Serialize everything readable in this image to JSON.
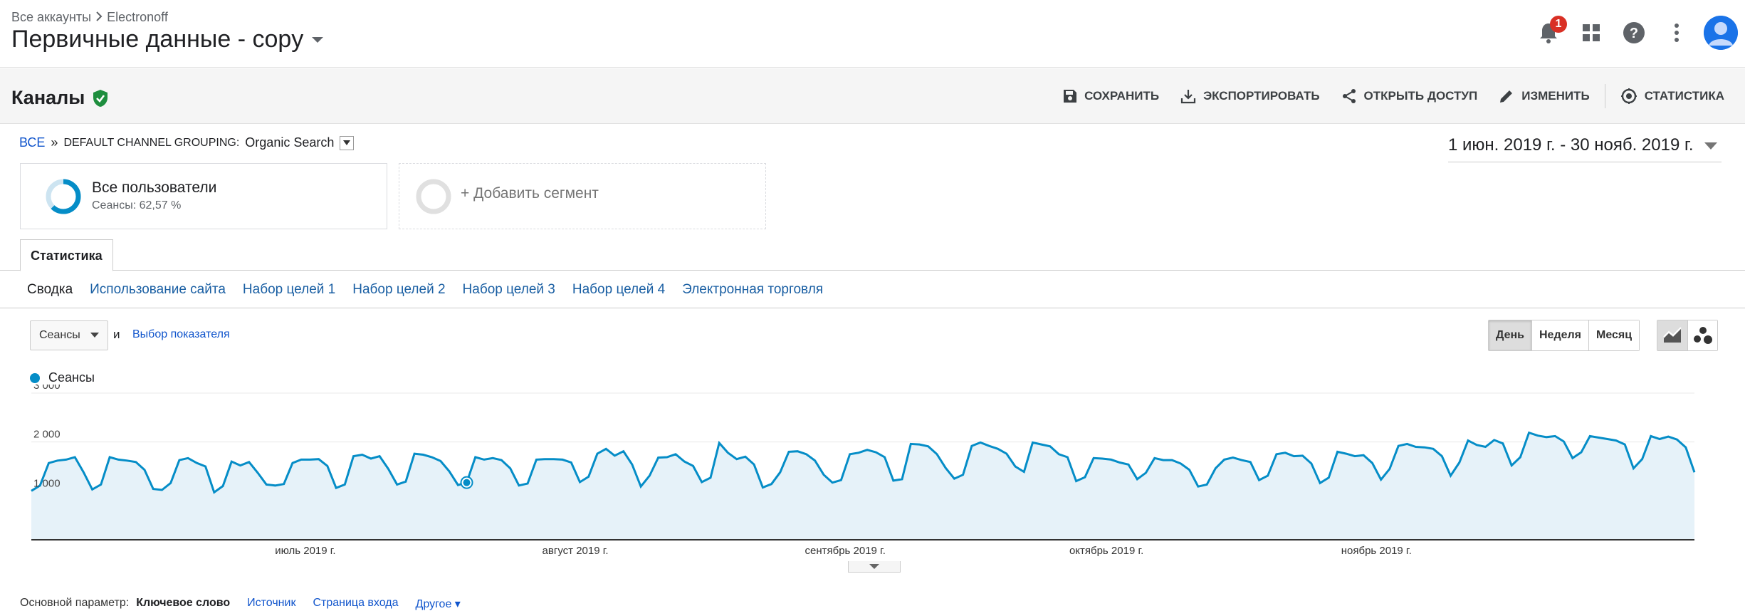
{
  "header": {
    "breadcrumb_root": "Все аккаунты",
    "breadcrumb_account": "Electronoff",
    "view_title": "Первичные данные - copy",
    "notification_count": "1"
  },
  "report": {
    "title": "Каналы",
    "actions": {
      "save": "СОХРАНИТЬ",
      "export": "ЭКСПОРТИРОВАТЬ",
      "share": "ОТКРЫТЬ ДОСТУП",
      "edit": "ИЗМЕНИТЬ",
      "insights": "СТАТИСТИКА"
    }
  },
  "drill": {
    "all": "ВСЕ",
    "sep": "»",
    "dimension": "DEFAULT CHANNEL GROUPING:",
    "value": "Organic Search"
  },
  "date_range": "1 июн. 2019 г. - 30 нояб. 2019 г.",
  "segments": {
    "active_name": "Все пользователи",
    "active_sub": "Сеансы: 62,57 %",
    "add": "+ Добавить сегмент"
  },
  "tab": "Статистика",
  "subtabs": [
    "Сводка",
    "Использование сайта",
    "Набор целей 1",
    "Набор целей 2",
    "Набор целей 3",
    "Набор целей 4",
    "Электронная торговля"
  ],
  "controls": {
    "metric": "Сеансы",
    "and": "и",
    "choose_metric": "Выбор показателя",
    "granularity": [
      "День",
      "Неделя",
      "Месяц"
    ]
  },
  "chart_data": {
    "type": "area",
    "series": [
      {
        "name": "Сеансы",
        "color": "#058dc7"
      }
    ],
    "y_ticks": [
      "3 000",
      "2 000",
      "1 000"
    ],
    "ylim": [
      0,
      3000
    ],
    "x_labels": [
      "июль 2019 г.",
      "август 2019 г.",
      "сентябрь 2019 г.",
      "октябрь 2019 г.",
      "ноябрь 2019 г."
    ],
    "x_start": "2019-06-01",
    "x_end": "2019-11-30",
    "grid": true,
    "values": [
      1000,
      1110,
      1570,
      1620,
      1640,
      1690,
      1380,
      1030,
      1130,
      1690,
      1640,
      1620,
      1590,
      1430,
      1040,
      1020,
      1160,
      1630,
      1670,
      1570,
      1500,
      970,
      1100,
      1600,
      1520,
      1590,
      1370,
      1130,
      1110,
      1140,
      1570,
      1640,
      1640,
      1650,
      1510,
      1060,
      1130,
      1710,
      1740,
      1660,
      1710,
      1450,
      1130,
      1190,
      1760,
      1740,
      1690,
      1610,
      1400,
      1120,
      1170,
      1690,
      1640,
      1670,
      1630,
      1460,
      1110,
      1150,
      1640,
      1650,
      1650,
      1640,
      1580,
      1180,
      1290,
      1760,
      1860,
      1720,
      1810,
      1540,
      1090,
      1310,
      1680,
      1690,
      1750,
      1600,
      1510,
      1180,
      1270,
      1980,
      1780,
      1650,
      1700,
      1540,
      1070,
      1140,
      1380,
      1800,
      1810,
      1750,
      1620,
      1330,
      1170,
      1220,
      1750,
      1780,
      1840,
      1790,
      1690,
      1210,
      1240,
      1960,
      1950,
      1910,
      1750,
      1470,
      1250,
      1330,
      1920,
      1990,
      1920,
      1860,
      1760,
      1500,
      1390,
      1990,
      1950,
      1910,
      1750,
      1690,
      1200,
      1280,
      1670,
      1660,
      1640,
      1580,
      1540,
      1240,
      1370,
      1670,
      1630,
      1630,
      1560,
      1430,
      1090,
      1130,
      1460,
      1640,
      1680,
      1630,
      1590,
      1220,
      1310,
      1750,
      1780,
      1710,
      1720,
      1560,
      1160,
      1270,
      1800,
      1760,
      1710,
      1730,
      1570,
      1230,
      1450,
      1920,
      1960,
      1900,
      1890,
      1860,
      1710,
      1310,
      1580,
      2030,
      1940,
      1900,
      2040,
      1970,
      1520,
      1690,
      2190,
      2130,
      2100,
      2120,
      2010,
      1670,
      1790,
      2120,
      2090,
      2060,
      2030,
      1950,
      1460,
      1650,
      2120,
      2060,
      2110,
      2050,
      1890,
      1380
    ]
  },
  "bottom": {
    "primary_label": "Основной параметр:",
    "primary_current": "Ключевое слово",
    "alt1": "Источник",
    "alt2": "Страница входа",
    "other": "Другое"
  }
}
